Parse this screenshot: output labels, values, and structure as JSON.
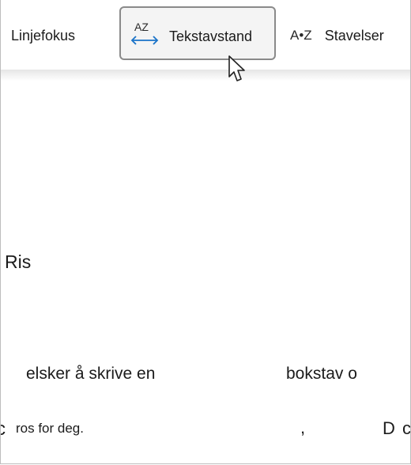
{
  "toolbar": {
    "items": [
      {
        "label": "Linjefokus",
        "icon": null,
        "selected": false
      },
      {
        "label": "Tekstavstand",
        "icon": "text-spacing-icon",
        "icon_text": "AZ",
        "selected": true
      },
      {
        "label": "Stavelser",
        "icon": "syllables-icon",
        "icon_text": "A•Z",
        "selected": false
      }
    ]
  },
  "document": {
    "word": "Ris",
    "line1_left": "elsker å skrive en",
    "line1_right": "bokstav o",
    "line2_left_fragment": "c",
    "line2_left": "ros for deg.",
    "line2_mid_fragment": ",",
    "line2_right_fragment": "D",
    "line2_right_fragment2": "c"
  },
  "colors": {
    "accent": "#1a73c8",
    "selected_border": "#8a8a8a",
    "selected_bg": "#f4f4f4"
  }
}
